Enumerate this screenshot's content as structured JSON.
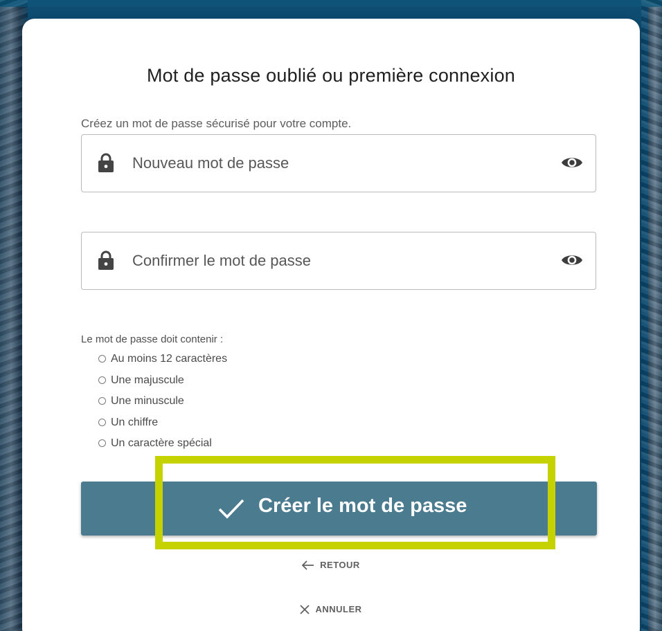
{
  "form": {
    "title": "Mot de passe oublié ou première connexion",
    "subtitle": "Créez un mot de passe sécurisé pour votre compte.",
    "new_password": {
      "placeholder": "Nouveau mot de passe",
      "value": "",
      "icon": "lock-icon",
      "toggle_icon": "eye-icon"
    },
    "confirm_password": {
      "placeholder": "Confirmer le mot de passe",
      "value": "",
      "icon": "lock-icon",
      "toggle_icon": "eye-icon"
    },
    "requirements_heading": "Le mot de passe doit contenir :",
    "requirements": [
      "Au moins 12 caractères",
      "Une majuscule",
      "Une minuscule",
      "Un chiffre",
      "Un caractère spécial"
    ],
    "submit_label": "Créer le mot de passe",
    "back_label": "RETOUR",
    "cancel_label": "ANNULER"
  },
  "colors": {
    "background": "#0e4c72",
    "card": "#ffffff",
    "button": "#4b7b8f",
    "highlight": "#c5d200"
  }
}
